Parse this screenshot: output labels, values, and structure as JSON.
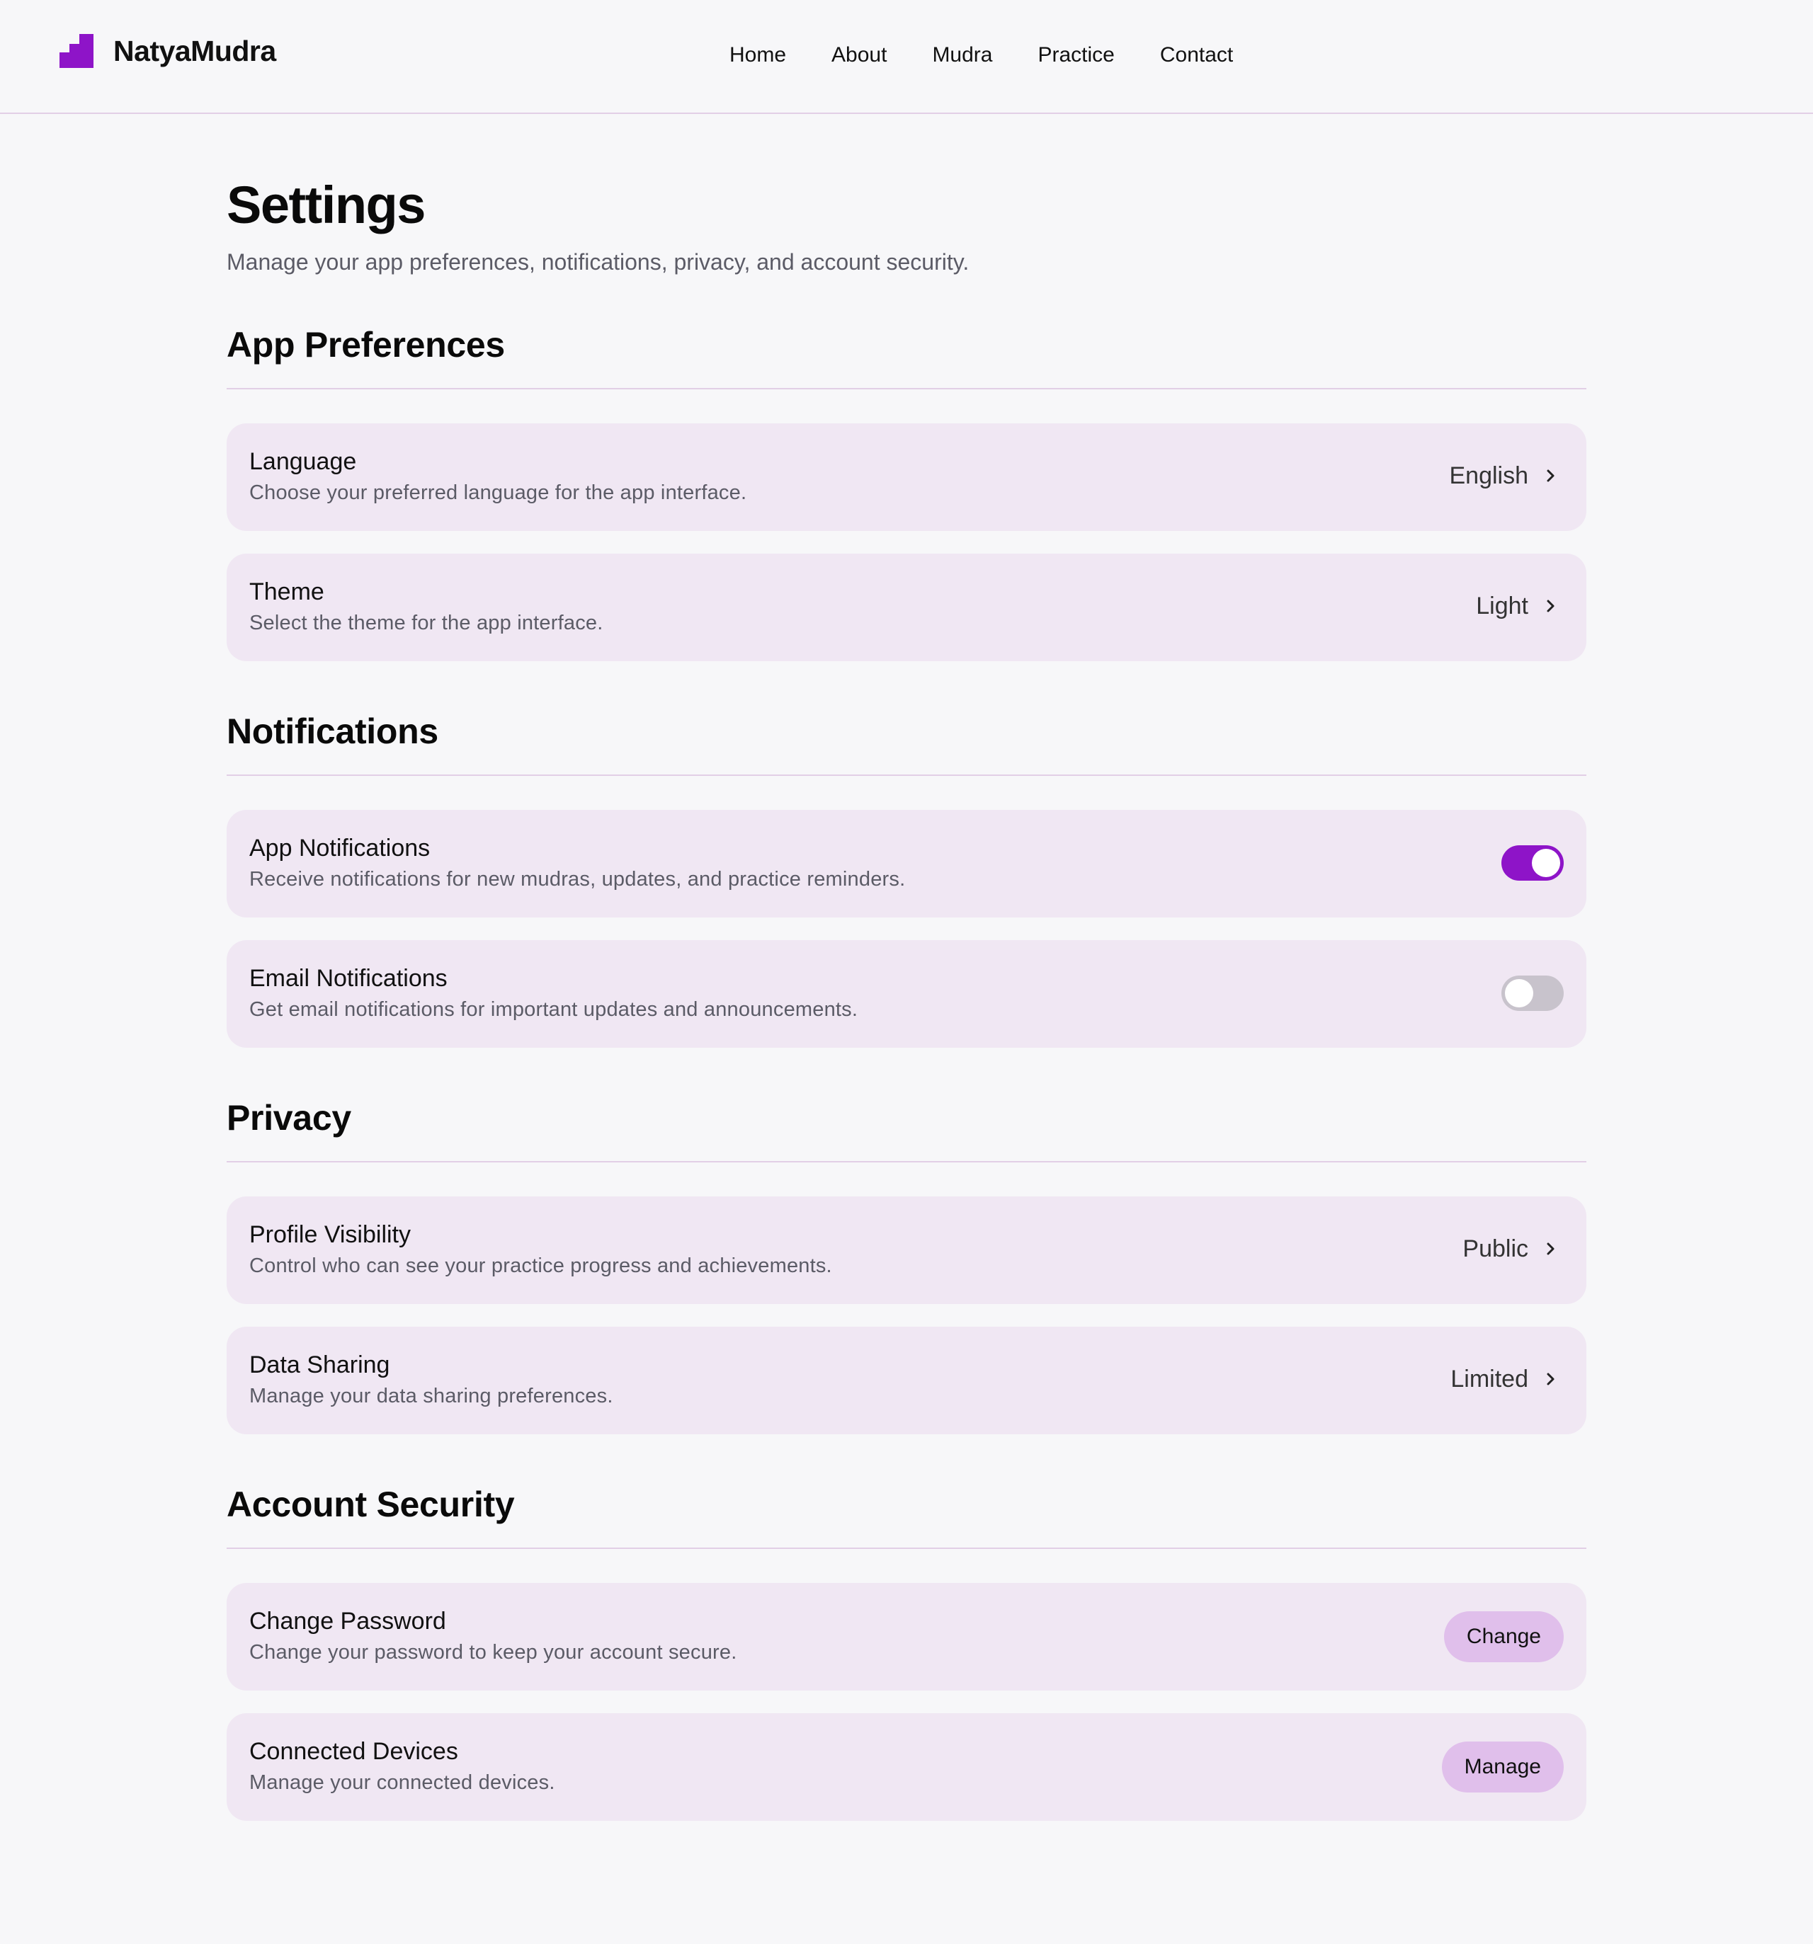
{
  "brand": {
    "name": "NatyaMudra",
    "logo_icon": "steps-logo-icon",
    "accent": "#8e14c8"
  },
  "nav": [
    "Home",
    "About",
    "Mudra",
    "Practice",
    "Contact"
  ],
  "page": {
    "title": "Settings",
    "subtitle": "Manage your app preferences, notifications, privacy, and account security."
  },
  "sections": {
    "app_preferences": {
      "title": "App Preferences",
      "language": {
        "label": "Language",
        "description": "Choose your preferred language for the app interface.",
        "value": "English"
      },
      "theme": {
        "label": "Theme",
        "description": "Select the theme for the app interface.",
        "value": "Light"
      }
    },
    "notifications": {
      "title": "Notifications",
      "app": {
        "label": "App Notifications",
        "description": "Receive notifications for new mudras, updates, and practice reminders.",
        "enabled": true
      },
      "email": {
        "label": "Email Notifications",
        "description": "Get email notifications for important updates and announcements.",
        "enabled": false
      }
    },
    "privacy": {
      "title": "Privacy",
      "profile_visibility": {
        "label": "Profile Visibility",
        "description": "Control who can see your practice progress and achievements.",
        "value": "Public"
      },
      "data_sharing": {
        "label": "Data Sharing",
        "description": "Manage your data sharing preferences.",
        "value": "Limited"
      }
    },
    "account_security": {
      "title": "Account Security",
      "change_password": {
        "label": "Change Password",
        "description": "Change your password to keep your account secure.",
        "button": "Change"
      },
      "connected_devices": {
        "label": "Connected Devices",
        "description": "Manage your connected devices.",
        "button": "Manage"
      }
    }
  }
}
